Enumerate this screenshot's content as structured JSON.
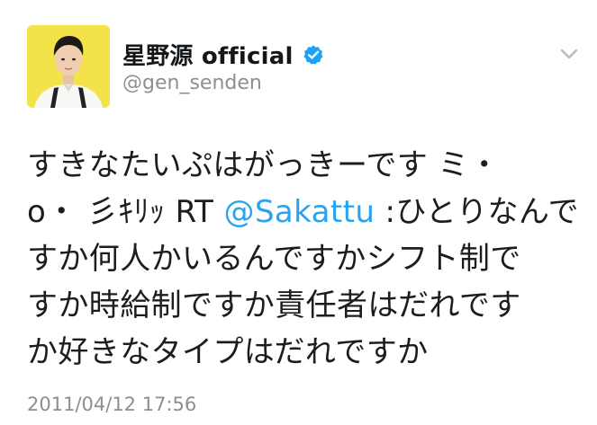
{
  "tweet": {
    "author": {
      "display_name": "星野源 official",
      "handle": "@gen_senden",
      "verified": true
    },
    "text_lines": [
      {
        "before": "すきなたいぷはがっきーです ミ・",
        "mention": "",
        "after": ""
      },
      {
        "before": "o・ 彡ｷﾘｯ RT ",
        "mention": "@Sakattu",
        "after": " :ひとりなんで"
      },
      {
        "before": "すか何人かいるんですかシフト制で",
        "mention": "",
        "after": ""
      },
      {
        "before": "すか時給制ですか責任者はだれです",
        "mention": "",
        "after": ""
      },
      {
        "before": "か好きなタイプはだれですか",
        "mention": "",
        "after": ""
      }
    ],
    "timestamp": "2011/04/12 17:56"
  },
  "icons": {
    "verified": "verified-badge-icon",
    "menu": "chevron-down-icon",
    "avatar": "profile-photo"
  },
  "colors": {
    "mention": "#2aa3ef",
    "verified_badge": "#1da1f2",
    "meta_text": "#8a8f96",
    "avatar_background": "#f3e24a"
  }
}
